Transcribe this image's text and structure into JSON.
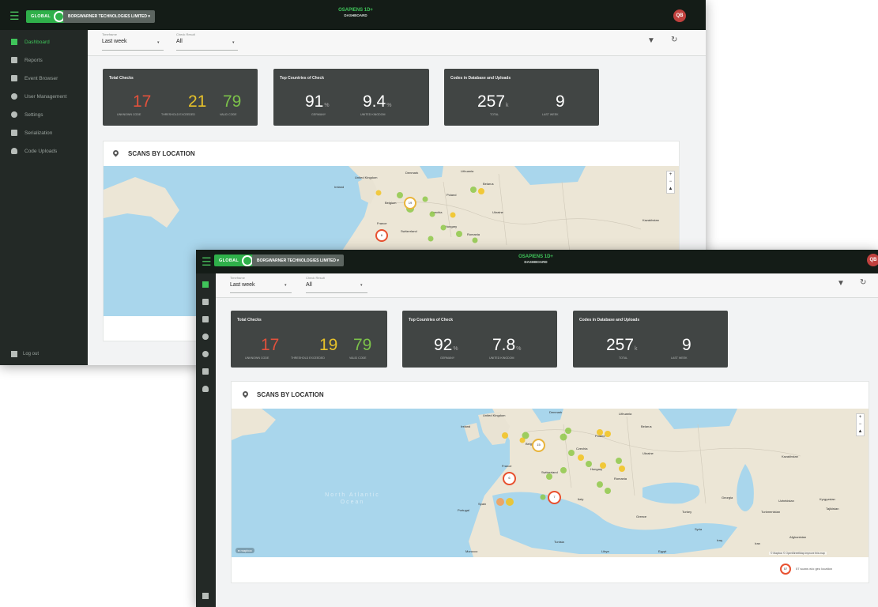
{
  "windows": [
    {
      "header": {
        "global_label": "GLOBAL",
        "company": "BORGWARNER TECHNOLOGIES LIMITED",
        "brand_title": "OSAPIENS 1D+",
        "brand_subtitle": "DASHBOARD",
        "avatar_initials": "QB"
      },
      "sidebar": {
        "items": [
          {
            "label": "Dashboard",
            "icon": "dashboard-icon"
          },
          {
            "label": "Reports",
            "icon": "reports-icon"
          },
          {
            "label": "Event Browser",
            "icon": "event-browser-icon"
          },
          {
            "label": "User Management",
            "icon": "user-management-icon"
          },
          {
            "label": "Settings",
            "icon": "settings-icon"
          },
          {
            "label": "Serialization",
            "icon": "serialization-icon"
          },
          {
            "label": "Code Uploads",
            "icon": "cloud-upload-icon"
          }
        ],
        "logout": "Log out"
      },
      "filters": {
        "timeframe_label": "Timeframe",
        "timeframe_value": "Last week",
        "check_result_label": "Check Result",
        "check_result_value": "All"
      },
      "kpis": {
        "total_checks": {
          "title": "Total Checks",
          "unknown": "17",
          "unknown_label": "UNKNOWN CODE",
          "threshold": "21",
          "threshold_label": "THRESHOLD EXCEEDED",
          "valid": "79",
          "valid_label": "VALID CODE"
        },
        "top_countries": {
          "title": "Top Countries of Check",
          "first_value": "91",
          "first_unit": "%",
          "first_label": "GERMANY",
          "second_value": "9.4",
          "second_unit": "%",
          "second_label": "UNITED KINGDOM"
        },
        "codes": {
          "title": "Codes in Database and Uploads",
          "total_value": "257",
          "total_unit": "k",
          "total_label": "TOTAL",
          "lastweek_value": "9",
          "lastweek_label": "LAST WEEK"
        }
      },
      "scans": {
        "title": "SCANS BY LOCATION"
      },
      "map": {
        "clusters": [
          "19",
          "6"
        ]
      }
    },
    {
      "header": {
        "global_label": "GLOBAL",
        "company": "BORGWARNER TECHNOLOGIES LIMITED",
        "brand_title": "OSAPIENS 1D+",
        "brand_subtitle": "DASHBOARD",
        "avatar_initials": "QB"
      },
      "filters": {
        "timeframe_label": "Timeframe",
        "timeframe_value": "Last week",
        "check_result_label": "Check Result",
        "check_result_value": "All"
      },
      "kpis": {
        "total_checks": {
          "title": "Total Checks",
          "unknown": "17",
          "unknown_label": "UNKNOWN CODE",
          "threshold": "19",
          "threshold_label": "THRESHOLD EXCEEDED",
          "valid": "79",
          "valid_label": "VALID CODE"
        },
        "top_countries": {
          "title": "Top Countries of Check",
          "first_value": "92",
          "first_unit": "%",
          "first_label": "GERMANY",
          "second_value": "7.8",
          "second_unit": "%",
          "second_label": "UNITED KINGDOM"
        },
        "codes": {
          "title": "Codes in Database and Uploads",
          "total_value": "257",
          "total_unit": "k",
          "total_label": "TOTAL",
          "lastweek_value": "9",
          "lastweek_label": "LAST WEEK"
        }
      },
      "scans": {
        "title": "SCANS BY LOCATION"
      },
      "map": {
        "ocean_label": "North Atlantic Ocean",
        "clusters": [
          "15",
          "6",
          "7"
        ],
        "attribution": "© Mapbox © OpenStreetMap Improve this map",
        "legend_count": "57",
        "legend_text": "57 scans w/o geo location"
      }
    }
  ],
  "map_labels": [
    "Denmark",
    "Lithuania",
    "United Kingdom",
    "Ireland",
    "Belarus",
    "Poland",
    "Belgium",
    "Czechia",
    "Ukraine",
    "France",
    "Switzerland",
    "Hungary",
    "Romania",
    "Kazakhstan",
    "Spain",
    "Portugal",
    "Italy",
    "Turkey",
    "Greece",
    "Uzbekistan",
    "Kyrgyzstan",
    "Tajikistan",
    "Turkmenistan",
    "Afghanistan",
    "Syria",
    "Iraq",
    "Iran",
    "Tunisia",
    "Morocco",
    "Libya",
    "Egypt",
    "Georgia"
  ],
  "colors": {
    "accent": "#2fb04a",
    "red": "#e2513c",
    "yellow": "#e6c12a",
    "green": "#7cc24a",
    "topbar": "#141c17",
    "sidebar": "#232926",
    "kpi": "#414544"
  }
}
